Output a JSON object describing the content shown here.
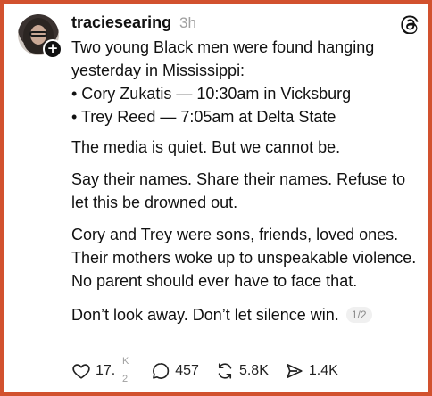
{
  "post": {
    "username": "traciesearing",
    "time": "3h",
    "intro": "Two young Black men were found hanging yesterday in Mississippi:",
    "bullets": [
      "• Cory Zukatis — 10:30am in Vicksburg",
      "• Trey Reed — 7:05am at Delta State"
    ],
    "para2": "The media is quiet. But we cannot be.",
    "para3": "Say their names. Share their names. Refuse to let this be drowned out.",
    "para4": "Cory and Trey were sons, friends, loved ones. Their mothers woke up to unspeakable violence. No parent should ever have to face that.",
    "para5": "Don’t look away. Don’t let silence win.",
    "pager": "1/2"
  },
  "actions": {
    "likes": "17.",
    "likes_sup": "K",
    "likes_sub": "2",
    "comments": "457",
    "reposts": "5.8K",
    "shares": "1.4K"
  },
  "icons": {
    "brand": "threads-icon",
    "like": "heart-icon",
    "comment": "comment-icon",
    "repost": "repost-icon",
    "share": "send-icon"
  },
  "colors": {
    "border": "#d2512e",
    "muted": "#a0a0a0"
  }
}
